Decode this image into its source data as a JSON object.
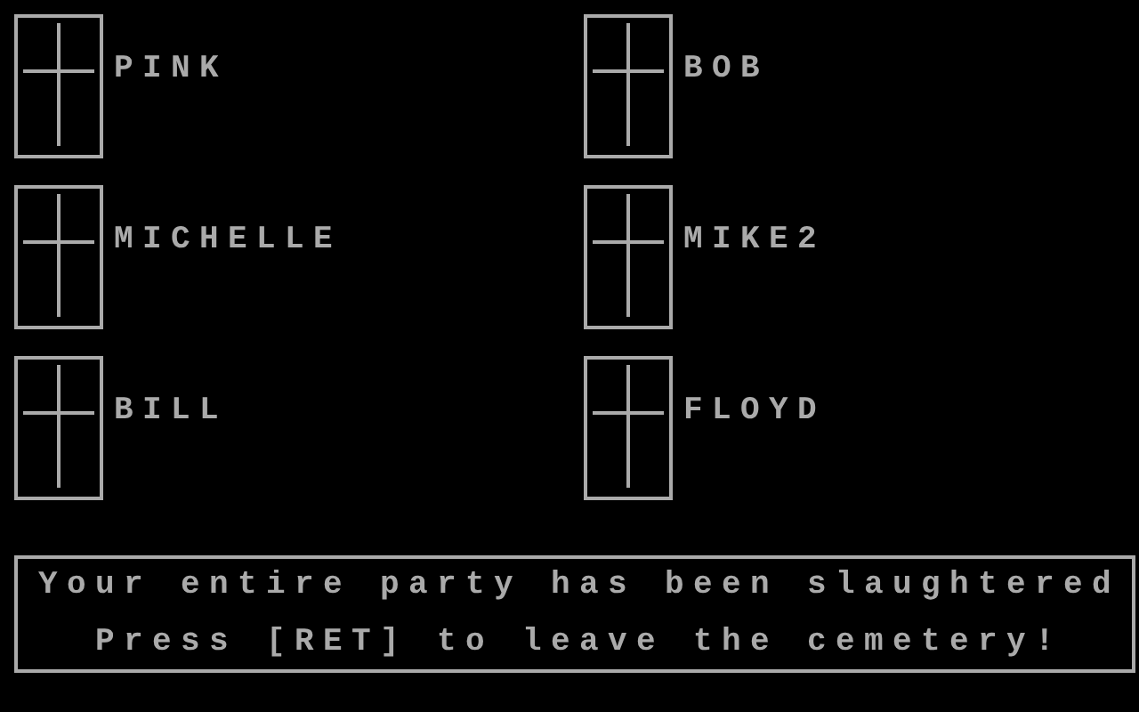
{
  "graves": [
    {
      "name": "PINK"
    },
    {
      "name": "BOB"
    },
    {
      "name": "MICHELLE"
    },
    {
      "name": "MIKE2"
    },
    {
      "name": "BILL"
    },
    {
      "name": "FLOYD"
    }
  ],
  "message": {
    "lines": [
      "Your entire party has been slaughtered",
      "Press [RET] to leave the cemetery!"
    ]
  }
}
